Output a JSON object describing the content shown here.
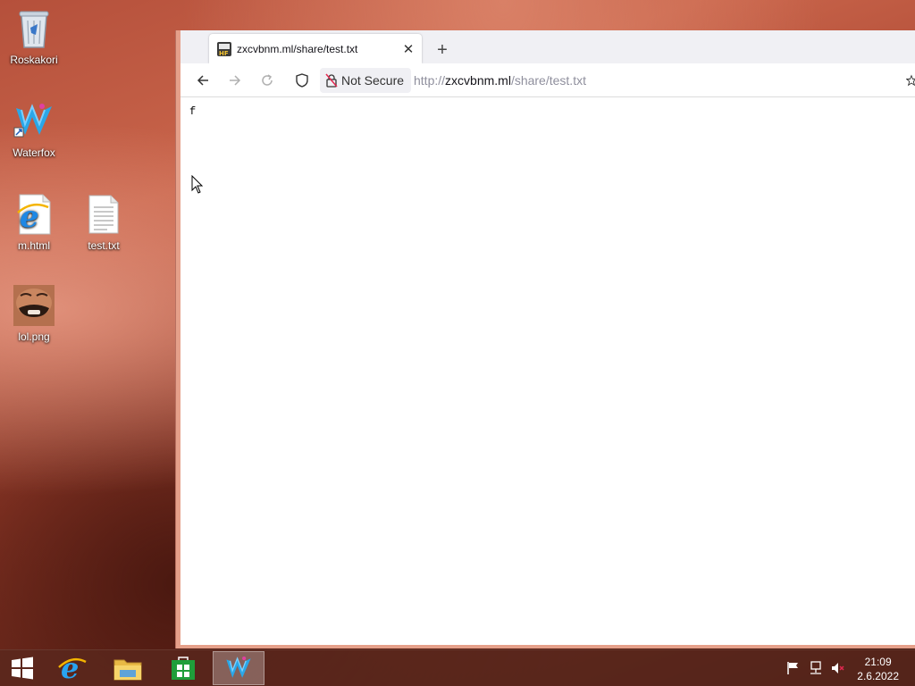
{
  "desktop": {
    "icons": [
      {
        "label": "Roskakori",
        "icon": "recycle-bin-icon"
      },
      {
        "label": "Waterfox",
        "icon": "waterfox-icon"
      },
      {
        "label": "m.html",
        "icon": "ie-file-icon"
      },
      {
        "label": "test.txt",
        "icon": "text-file-icon"
      },
      {
        "label": "lol.png",
        "icon": "image-thumbnail-icon"
      }
    ]
  },
  "browser": {
    "tab_title": "zxcvbnm.ml/share/test.txt",
    "new_tab_label": "+",
    "close_label": "✕",
    "not_secure_label": "Not Secure",
    "url_scheme": "http://",
    "url_host": "zxcvbnm.ml",
    "url_path": "/share/test.txt",
    "page_text": "f"
  },
  "taskbar": {
    "time": "21:09",
    "date": "2.6.2022",
    "pinned": [
      "start-icon",
      "internet-explorer-icon",
      "file-explorer-icon",
      "store-icon",
      "waterfox-icon"
    ],
    "tray": [
      "action-center-flag-icon",
      "network-icon",
      "volume-muted-icon"
    ]
  },
  "colors": {
    "accent": "#2a7de1",
    "store_green": "#1f9e3a",
    "ie_blue": "#1e88e5"
  }
}
